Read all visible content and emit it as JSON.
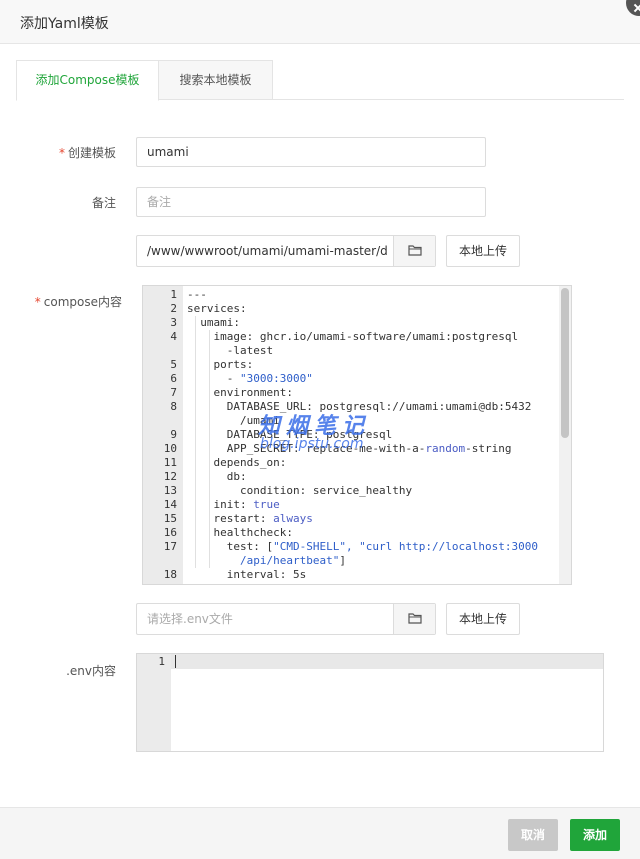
{
  "dialog": {
    "title": "添加Yaml模板"
  },
  "tabs": [
    {
      "label": "添加Compose模板",
      "active": true
    },
    {
      "label": "搜索本地模板",
      "active": false
    }
  ],
  "form": {
    "template_name": {
      "label": "创建模板",
      "required": "*",
      "value": "umami"
    },
    "remark": {
      "label": "备注",
      "placeholder": "备注"
    },
    "compose_path": {
      "value": "/www/wwwroot/umami/umami-master/d",
      "upload_label": "本地上传"
    },
    "compose_content": {
      "label": "compose内容",
      "required": "*"
    },
    "env_file": {
      "placeholder": "请选择.env文件",
      "upload_label": "本地上传"
    },
    "env_content": {
      "label": ".env内容",
      "line_number": "1"
    }
  },
  "compose_lines": [
    {
      "n": "1",
      "t": "---"
    },
    {
      "n": "2",
      "t": "services:"
    },
    {
      "n": "3",
      "t": "  umami:"
    },
    {
      "n": "4",
      "t": "    image: ghcr.io/umami-software/umami:postgresql"
    },
    {
      "n": "",
      "t": "      -latest"
    },
    {
      "n": "5",
      "t": "    ports:"
    },
    {
      "n": "6",
      "a": "      - ",
      "s": "\"3000:3000\""
    },
    {
      "n": "7",
      "t": "    environment:"
    },
    {
      "n": "8",
      "t": "      DATABASE_URL: postgresql://umami:umami@db:5432"
    },
    {
      "n": "",
      "t": "        /umami"
    },
    {
      "n": "9",
      "t": "      DATABASE_TYPE: postgresql"
    },
    {
      "n": "10",
      "a": "      APP_SECRET: replace-me-with-a-",
      "k": "random",
      "b": "-string"
    },
    {
      "n": "11",
      "t": "    depends_on:"
    },
    {
      "n": "12",
      "t": "      db:"
    },
    {
      "n": "13",
      "t": "        condition: service_healthy"
    },
    {
      "n": "14",
      "a": "    init: ",
      "k": "true"
    },
    {
      "n": "15",
      "a": "    restart: ",
      "k": "always"
    },
    {
      "n": "16",
      "t": "    healthcheck:"
    },
    {
      "n": "17",
      "a": "      test: [",
      "s": "\"CMD-SHELL\", \"curl http://localhost:3000"
    },
    {
      "n": "",
      "s": "        /api/heartbeat\"",
      "b": "]"
    },
    {
      "n": "18",
      "t": "      interval: 5s"
    }
  ],
  "watermark": {
    "main": "知烟笔记",
    "sub": "blog.ipstu.com"
  },
  "footer": {
    "cancel_label": "取消",
    "add_label": "添加"
  },
  "colors": {
    "accent": "#20a53a",
    "required": "#e5462f",
    "string": "#2e5ec9"
  }
}
